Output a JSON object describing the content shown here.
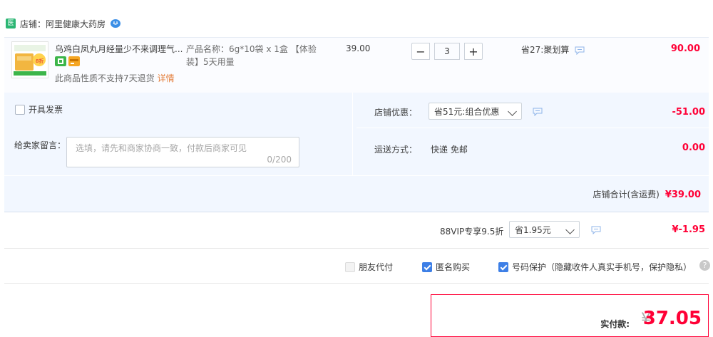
{
  "store": {
    "badge": "医",
    "name": "店铺：阿里健康大药房"
  },
  "item": {
    "title": "乌鸡白凤丸月经量少不来调理气...",
    "spec": "产品名称：6g*10袋 x 1盒 【体验装】5天用量",
    "no_return_note": "此商品性质不支持7天退货",
    "detail_link": "详情",
    "unit_price": "39.00",
    "quantity": "3",
    "minus_symbol": "−",
    "plus_symbol": "+",
    "save_label": "省27:聚划算",
    "row_total": "90.00",
    "thumb_text": "8折"
  },
  "invoice": {
    "label": "开具发票"
  },
  "buyer_message": {
    "label": "给卖家留言：",
    "placeholder": "选填，请先和商家协商一致，付款后商家可见",
    "count": "0/200"
  },
  "store_discount": {
    "label": "店铺优惠：",
    "selected": "省51元:组合优惠",
    "amount": "-51.00"
  },
  "shipping": {
    "label": "运送方式：",
    "value": "快递 免邮",
    "amount": "0.00"
  },
  "store_total": {
    "label": "店铺合计(含运费)",
    "amount": "¥39.00"
  },
  "vip": {
    "label": "88VIP专享9.5折",
    "selected": "省1.95元",
    "amount": "¥-1.95"
  },
  "options": [
    {
      "label": "朋友代付",
      "checked": false
    },
    {
      "label": "匿名购买",
      "checked": true
    },
    {
      "label": "号码保护（隐藏收件人真实手机号，保护隐私）",
      "checked": true
    }
  ],
  "help_symbol": "?",
  "payment": {
    "label": "实付款:",
    "currency": "¥",
    "amount": "37.05"
  },
  "colors": {
    "accent_red": "#ff0036",
    "checkbox_blue": "#3d7fe6",
    "panel_bg": "#f2f7ff",
    "store_badge_green": "#2bb673"
  }
}
